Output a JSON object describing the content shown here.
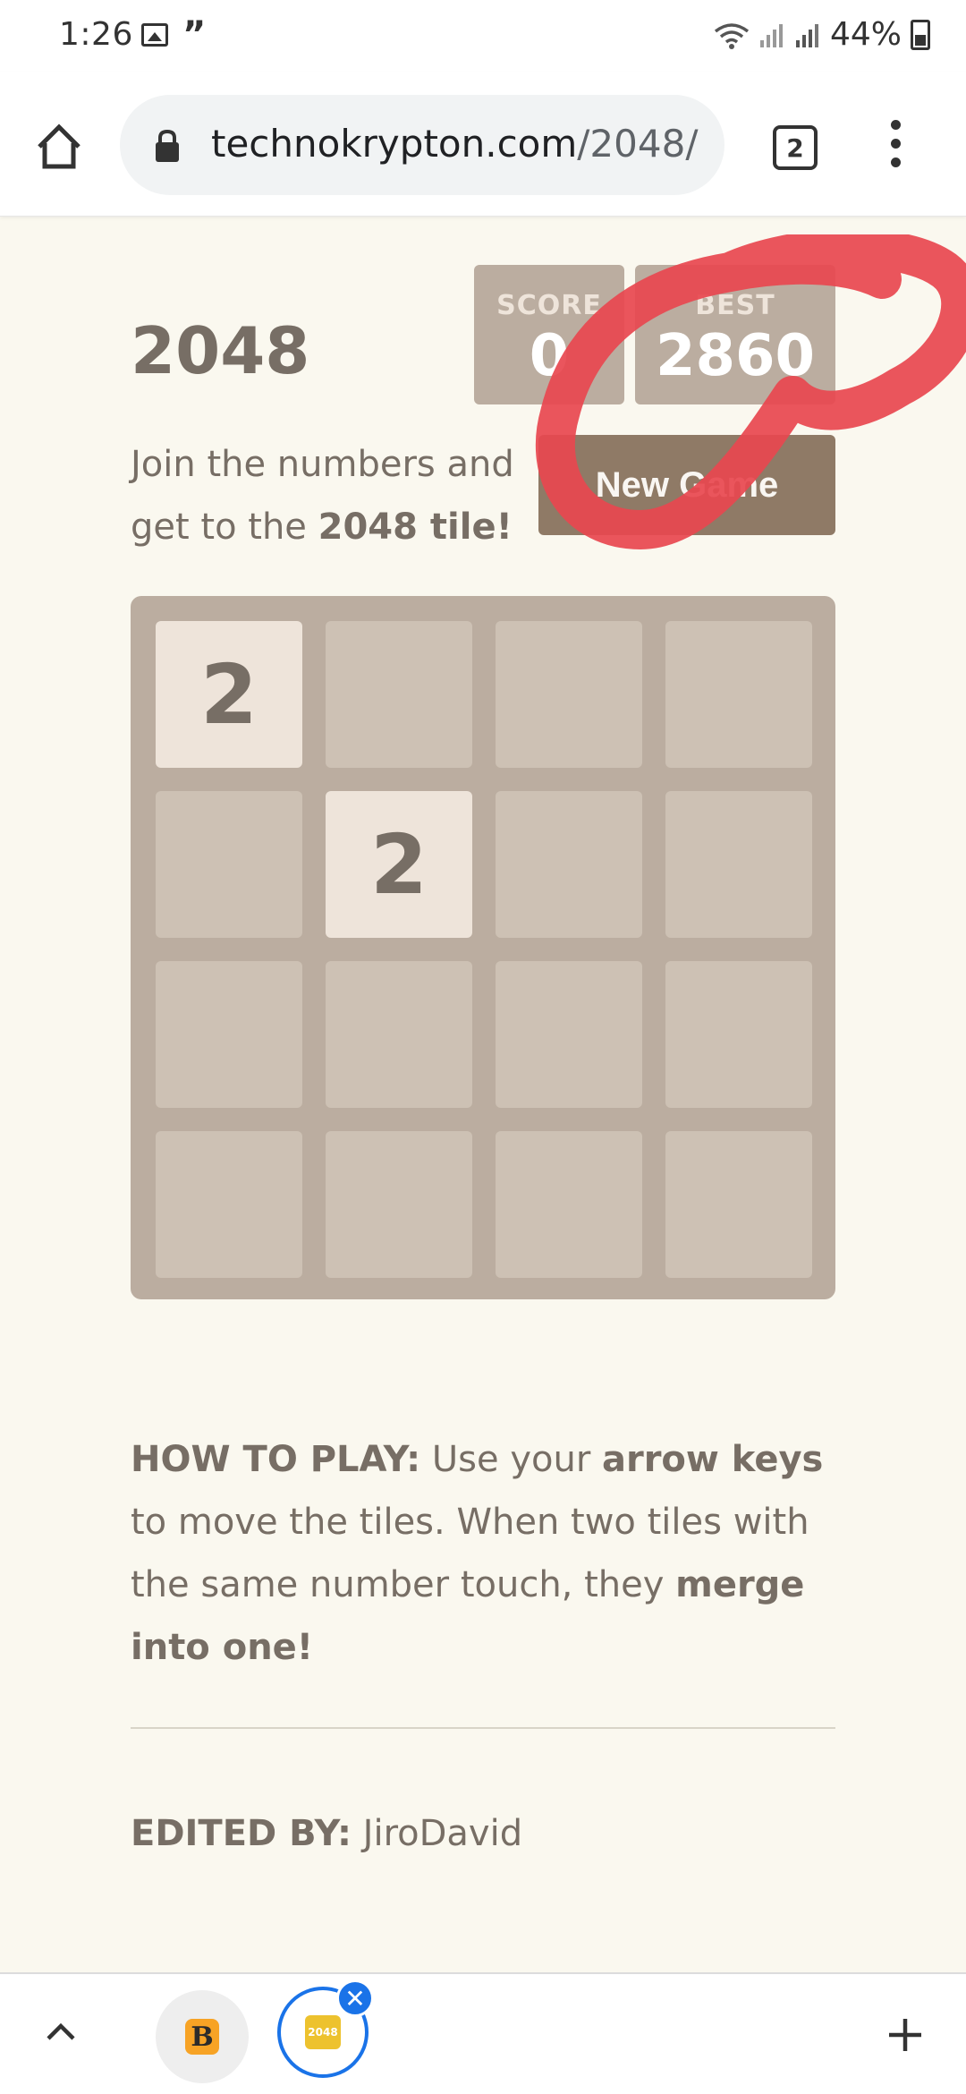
{
  "status_bar": {
    "time": "1:26",
    "battery": "44%"
  },
  "browser": {
    "url_domain": "technokrypton.com",
    "url_path": "/2048/",
    "tab_count": "2"
  },
  "game": {
    "title": "2048",
    "score_label": "SCORE",
    "score_value": "0",
    "best_label": "BEST",
    "best_value": "2860",
    "intro_text_1": "Join the numbers and get to the ",
    "intro_bold": "2048 tile!",
    "new_game_label": "New Game",
    "grid": [
      [
        "2",
        "",
        "",
        ""
      ],
      [
        "",
        "2",
        "",
        ""
      ],
      [
        "",
        "",
        "",
        ""
      ],
      [
        "",
        "",
        "",
        ""
      ]
    ]
  },
  "how_to_play": {
    "heading": "HOW TO PLAY:",
    "text_1": " Use your ",
    "bold_1": "arrow keys",
    "text_2": " to move the tiles. When two tiles with the same number touch, they ",
    "bold_2": "merge into one!"
  },
  "credits": {
    "label": "EDITED BY:",
    "name": " JiroDavid"
  },
  "bottom_bar": {
    "tab_b_letter": "B",
    "tab_2048_label": "2048"
  },
  "colors": {
    "background": "#faf8ef",
    "grid": "#bbada0",
    "empty_cell": "#cdc1b4",
    "tile_2": "#eee4da",
    "button": "#8f7a66",
    "annotation": "#e8474f"
  }
}
